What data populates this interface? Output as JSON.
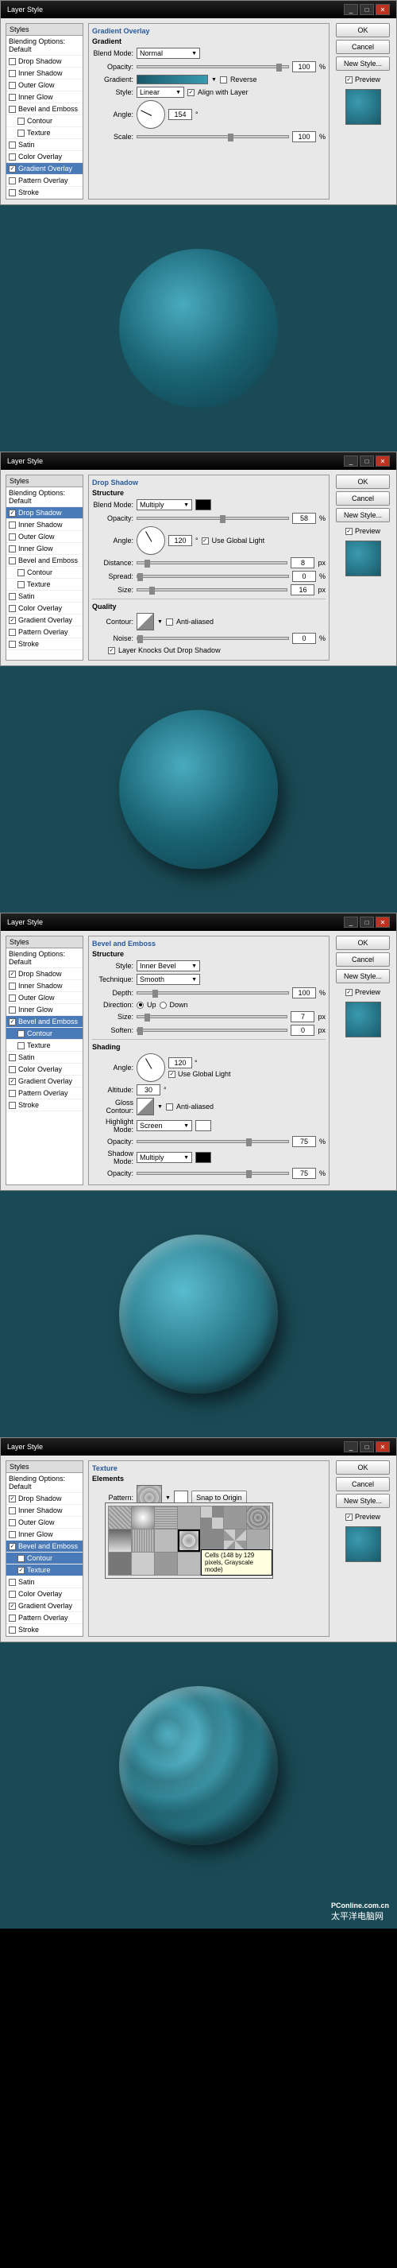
{
  "dialog_title": "Layer Style",
  "buttons": {
    "ok": "OK",
    "cancel": "Cancel",
    "newstyle": "New Style...",
    "preview": "Preview",
    "snap": "Snap to Origin"
  },
  "styles_header": "Styles",
  "blending_opts": "Blending Options: Default",
  "styles_list": [
    "Drop Shadow",
    "Inner Shadow",
    "Outer Glow",
    "Inner Glow",
    "Bevel and Emboss",
    "Contour",
    "Texture",
    "Satin",
    "Color Overlay",
    "Gradient Overlay",
    "Pattern Overlay",
    "Stroke"
  ],
  "labels": {
    "blend_mode": "Blend Mode:",
    "opacity": "Opacity:",
    "gradient": "Gradient:",
    "reverse": "Reverse",
    "style": "Style:",
    "align_layer": "Align with Layer",
    "angle": "Angle:",
    "scale": "Scale:",
    "structure": "Structure",
    "distance": "Distance:",
    "spread": "Spread:",
    "size": "Size:",
    "quality": "Quality",
    "contour": "Contour:",
    "antialiased": "Anti-aliased",
    "noise": "Noise:",
    "knockout": "Layer Knocks Out Drop Shadow",
    "use_global": "Use Global Light",
    "technique": "Technique:",
    "depth": "Depth:",
    "direction": "Direction:",
    "up": "Up",
    "down": "Down",
    "shading": "Shading",
    "altitude": "Altitude:",
    "gloss": "Gloss Contour:",
    "highlight": "Highlight Mode:",
    "shadow_mode": "Shadow Mode:",
    "soften": "Soften:",
    "elements": "Elements",
    "pattern": "Pattern:"
  },
  "sections": {
    "grad_overlay": "Gradient Overlay",
    "gradient": "Gradient",
    "drop_shadow": "Drop Shadow",
    "bevel": "Bevel and Emboss",
    "texture": "Texture"
  },
  "units": {
    "pct": "%",
    "deg": "°",
    "px": "px"
  },
  "p1": {
    "blend_mode": "Normal",
    "opacity": "100",
    "style": "Linear",
    "angle": "154",
    "scale": "100",
    "gradient_colors": [
      "#195a6a",
      "#3a9ab0"
    ],
    "preview": "#2a7a8a"
  },
  "p2": {
    "blend_mode": "Multiply",
    "opacity": "58",
    "angle": "120",
    "distance": "8",
    "spread": "0",
    "size": "16",
    "noise": "0",
    "shadow_color": "#000000",
    "preview": "#2a7a8a"
  },
  "p3": {
    "style": "Inner Bevel",
    "technique": "Smooth",
    "depth": "100",
    "size": "7",
    "soften": "0",
    "angle": "120",
    "altitude": "30",
    "highlight": "Screen",
    "hl_opacity": "75",
    "shadow_mode": "Multiply",
    "sh_opacity": "75",
    "preview": "#2a7a8a"
  },
  "p4": {
    "tooltip": "Cells (148 by 129 pixels, Grayscale mode)",
    "preview": "#2a7a8a"
  },
  "watermark1": "PConline.com.cn",
  "watermark2": "太平洋电脑网",
  "render_bg": "#1a4a55",
  "chart_data": null
}
